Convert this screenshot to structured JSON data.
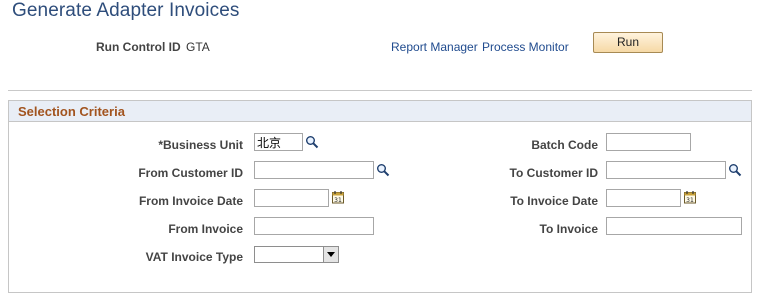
{
  "page": {
    "title": "Generate Adapter Invoices"
  },
  "run_control": {
    "label": "Run Control ID",
    "value": "GTA",
    "report_manager_link": "Report Manager",
    "process_monitor_link": "Process Monitor",
    "run_button": "Run"
  },
  "selection": {
    "title": "Selection Criteria",
    "business_unit": {
      "label": "*Business Unit",
      "value": "北京"
    },
    "batch_code": {
      "label": "Batch Code",
      "value": ""
    },
    "from_customer_id": {
      "label": "From Customer ID",
      "value": ""
    },
    "to_customer_id": {
      "label": "To Customer ID",
      "value": ""
    },
    "from_invoice_date": {
      "label": "From Invoice Date",
      "value": ""
    },
    "to_invoice_date": {
      "label": "To Invoice Date",
      "value": ""
    },
    "from_invoice": {
      "label": "From Invoice",
      "value": ""
    },
    "to_invoice": {
      "label": "To Invoice",
      "value": ""
    },
    "vat_invoice_type": {
      "label": "VAT Invoice Type",
      "value": ""
    }
  },
  "icons": {
    "lookup": "magnifier-lookup-icon",
    "calendar": "calendar-icon",
    "dropdown": "dropdown-arrow-icon"
  },
  "colors": {
    "title": "#2e4d7b",
    "link": "#214c8f",
    "section_title": "#a2541f",
    "section_header_bg": "#e9eef6",
    "run_button_bg": "#f6d9a6"
  }
}
